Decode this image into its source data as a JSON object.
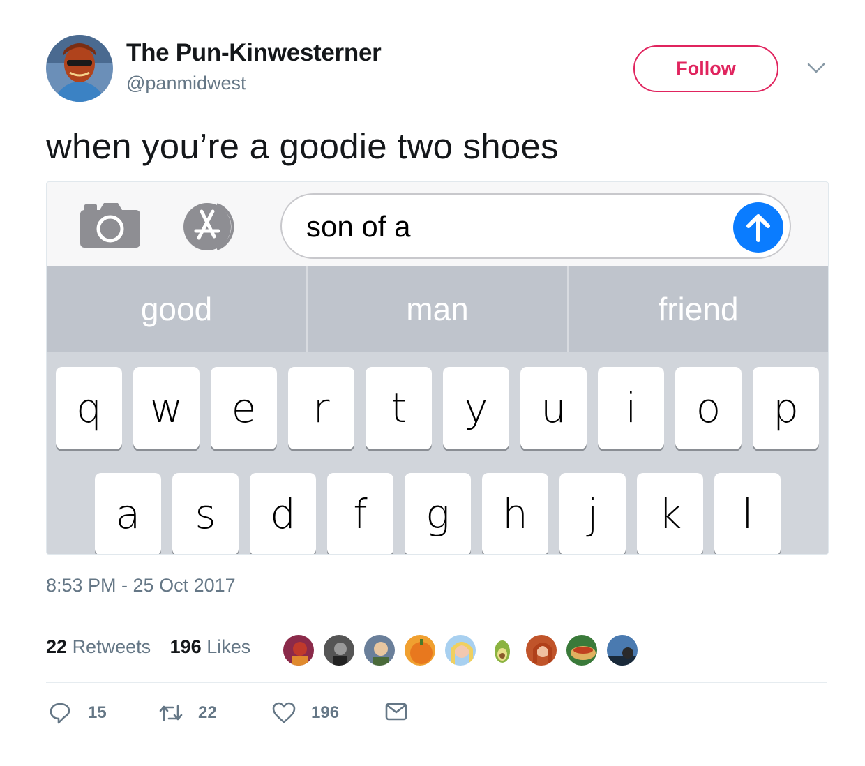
{
  "user": {
    "display_name": "The Pun-Kinwesterner",
    "handle": "@panmidwest",
    "follow_label": "Follow"
  },
  "tweet": {
    "text": "when you’re a goodie two shoes"
  },
  "imessage": {
    "field_text": "son of a",
    "suggestions": [
      "good",
      "man",
      "friend"
    ],
    "keyboard_row1": [
      "q",
      "w",
      "e",
      "r",
      "t",
      "y",
      "u",
      "i",
      "o",
      "p"
    ],
    "keyboard_row2": [
      "a",
      "s",
      "d",
      "f",
      "g",
      "h",
      "j",
      "k",
      "l"
    ]
  },
  "meta": {
    "timestamp": "8:53 PM - 25 Oct 2017"
  },
  "stats": {
    "retweets_count": "22",
    "retweets_label": "Retweets",
    "likes_count": "196",
    "likes_label": "Likes"
  },
  "actions": {
    "reply_count": "15",
    "retweet_count": "22",
    "like_count": "196"
  },
  "colors": {
    "follow": "#e0245e",
    "send_button": "#0a7cff",
    "secondary_text": "#657786"
  },
  "icons": [
    "avatar",
    "caret-down-icon",
    "camera-icon",
    "app-store-icon",
    "send-arrow-icon",
    "reply-icon",
    "retweet-icon",
    "like-icon",
    "direct-message-icon"
  ]
}
